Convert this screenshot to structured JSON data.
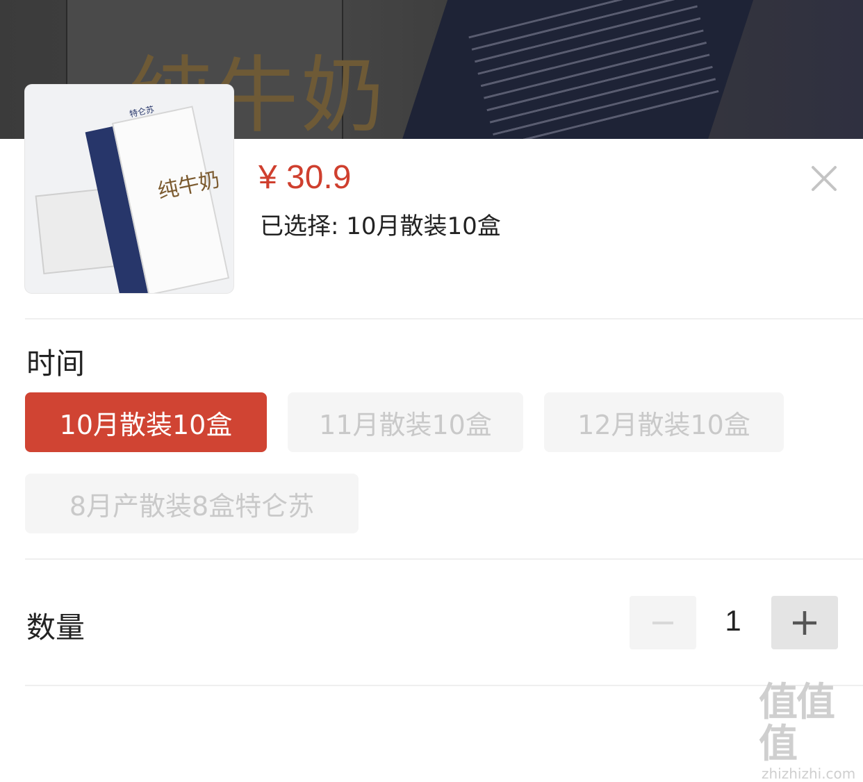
{
  "product": {
    "price": "¥ 30.9",
    "selected_text": "已选择: 10月散装10盒",
    "image_icon": "milk-carton-product-image"
  },
  "spec": {
    "label": "时间",
    "options": [
      {
        "label": "10月散装10盒",
        "state": "selected"
      },
      {
        "label": "11月散装10盒",
        "state": "disabled"
      },
      {
        "label": "12月散装10盒",
        "state": "disabled"
      },
      {
        "label": "8月产散装8盒特仑苏",
        "state": "disabled"
      }
    ]
  },
  "quantity": {
    "label": "数量",
    "value": "1",
    "minus_icon": "minus-icon",
    "plus_icon": "plus-icon"
  },
  "colors": {
    "accent": "#d04433",
    "price": "#cf3f2e",
    "disabled_bg": "#f5f5f5",
    "disabled_text": "#c9c9c9"
  },
  "watermark": {
    "logo": "值值值",
    "url": "zhizhizhi.com"
  }
}
